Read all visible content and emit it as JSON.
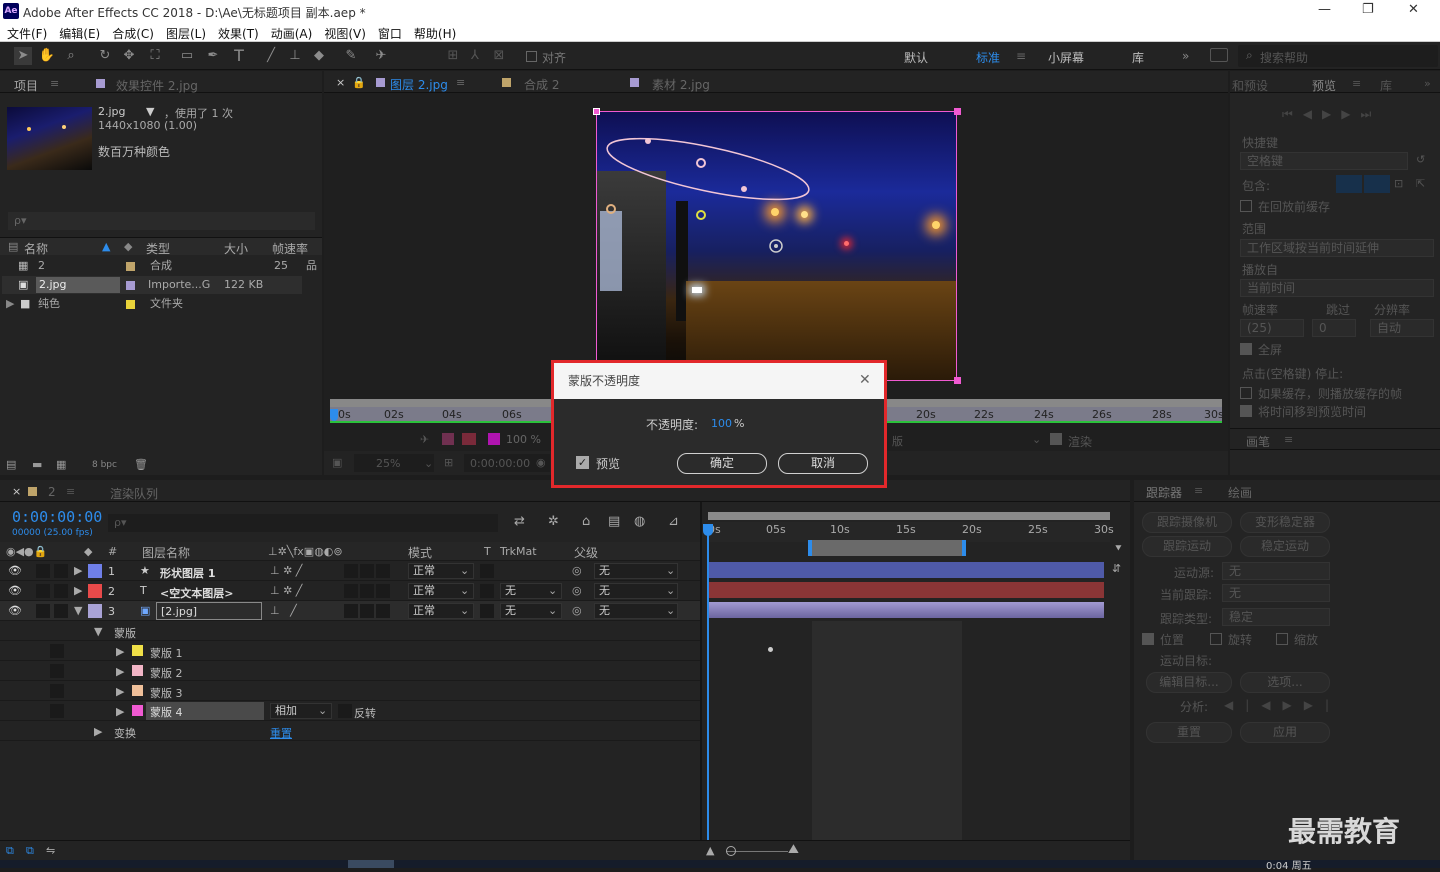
{
  "window": {
    "logo": "Ae",
    "title": "Adobe After Effects CC 2018 - D:\\Ae\\无标题项目 副本.aep *",
    "min": "—",
    "max": "❐",
    "close": "✕"
  },
  "menu": [
    "文件(F)",
    "编辑(E)",
    "合成(C)",
    "图层(L)",
    "效果(T)",
    "动画(A)",
    "视图(V)",
    "窗口",
    "帮助(H)"
  ],
  "toolbar": {
    "align": "对齐",
    "workspaces": [
      "默认",
      "标准",
      "小屏幕",
      "库"
    ],
    "search_placeholder": "搜索帮助",
    "more": "»"
  },
  "project": {
    "tab": "项目",
    "effects_tab": "效果控件 2.jpg",
    "file_name": "2.jpg",
    "used": "，使用了 1 次",
    "dims": "1440x1080 (1.00)",
    "colors": "数百万种颜色",
    "search_icon": "ρ▾",
    "columns": [
      "名称",
      "类型",
      "大小",
      "帧速率"
    ],
    "rows": [
      {
        "name": "2",
        "type": "合成",
        "size": "",
        "fps": "25",
        "color": "#bfa46a"
      },
      {
        "name": "2.jpg",
        "type": "Importe...G",
        "size": "122 KB",
        "fps": "",
        "color": "#a79bd2"
      },
      {
        "name": "纯色",
        "type": "文件夹",
        "size": "",
        "fps": "",
        "color": "#e9d33a"
      }
    ],
    "bpc": "8 bpc"
  },
  "viewer": {
    "tabs": [
      "图层 2.jpg",
      "合成 2",
      "素材 2.jpg"
    ],
    "ruler": [
      "0s",
      "02s",
      "04s",
      "06s",
      "20s",
      "22s",
      "24s",
      "26s",
      "28s",
      "30s"
    ],
    "opacity": "100 %",
    "zoom": "25%",
    "time": "0:00:00:00",
    "view": "版",
    "render": "渲染"
  },
  "preview": {
    "tabs": [
      "和预设",
      "预览",
      "库"
    ],
    "shortcut_label": "快捷键",
    "shortcut_value": "空格键",
    "include": "包含:",
    "cache": "在回放前缓存",
    "range_label": "范围",
    "range_value": "工作区域按当前时间延伸",
    "play_label": "播放自",
    "play_value": "当前时间",
    "fps_label": "帧速率",
    "skip_label": "跳过",
    "res_label": "分辨率",
    "fps_value": "(25)",
    "skip_value": "0",
    "res_value": "自动",
    "fullscreen": "全屏",
    "stop_label": "点击(空格键) 停止:",
    "stop_cache": "如果缓存，则播放缓存的帧",
    "stop_move": "将时间移到预览时间",
    "brush_tab": "画笔"
  },
  "dialog": {
    "title": "蒙版不透明度",
    "label": "不透明度:",
    "value": "100",
    "unit": "%",
    "preview": "预览",
    "ok": "确定",
    "cancel": "取消"
  },
  "timeline": {
    "comp_tab": "2",
    "render_queue": "渲染队列",
    "timecode": "0:00:00:00",
    "frames": "00000 (25.00 fps)",
    "cols": {
      "num": "#",
      "name": "图层名称",
      "mode": "模式",
      "t": "T",
      "trkmat": "TrkMat",
      "parent": "父级"
    },
    "layers": [
      {
        "num": "1",
        "icon": "★",
        "name": "形状图层 1",
        "mode": "正常",
        "trk": "",
        "parent": "无",
        "color": "#6f7fe8"
      },
      {
        "num": "2",
        "icon": "T",
        "name": "<空文本图层>",
        "mode": "正常",
        "trk": "无",
        "parent": "无",
        "color": "#e84a4a"
      },
      {
        "num": "3",
        "icon": "▣",
        "name": "[2.jpg]",
        "mode": "正常",
        "trk": "无",
        "parent": "无",
        "color": "#a9a3d6"
      }
    ],
    "masks_group": "蒙版",
    "masks": [
      {
        "name": "蒙版 1",
        "color": "#f0e048"
      },
      {
        "name": "蒙版 2",
        "color": "#f2b5c6"
      },
      {
        "name": "蒙版 3",
        "color": "#f0c09a"
      },
      {
        "name": "蒙版 4",
        "color": "#f05ad2"
      }
    ],
    "mask_mode": "相加",
    "invert": "反转",
    "transform": "变换",
    "reset": "重置",
    "ruler": [
      "0s",
      "05s",
      "10s",
      "15s",
      "20s",
      "25s",
      "30s"
    ]
  },
  "tracker": {
    "tabs": [
      "跟踪器",
      "绘画"
    ],
    "track_camera": "跟踪摄像机",
    "warp": "变形稳定器",
    "track_motion": "跟踪运动",
    "stabilize": "稳定运动",
    "source_label": "运动源:",
    "source_value": "无",
    "current_label": "当前跟踪:",
    "current_value": "无",
    "type_label": "跟踪类型:",
    "type_value": "稳定",
    "position": "位置",
    "rotation": "旋转",
    "scale": "缩放",
    "target_label": "运动目标:",
    "edit_target": "编辑目标...",
    "options": "选项...",
    "analyze": "分析:",
    "reset": "重置",
    "apply": "应用"
  },
  "watermark": "最需教育",
  "status_time": "0:04 周五"
}
